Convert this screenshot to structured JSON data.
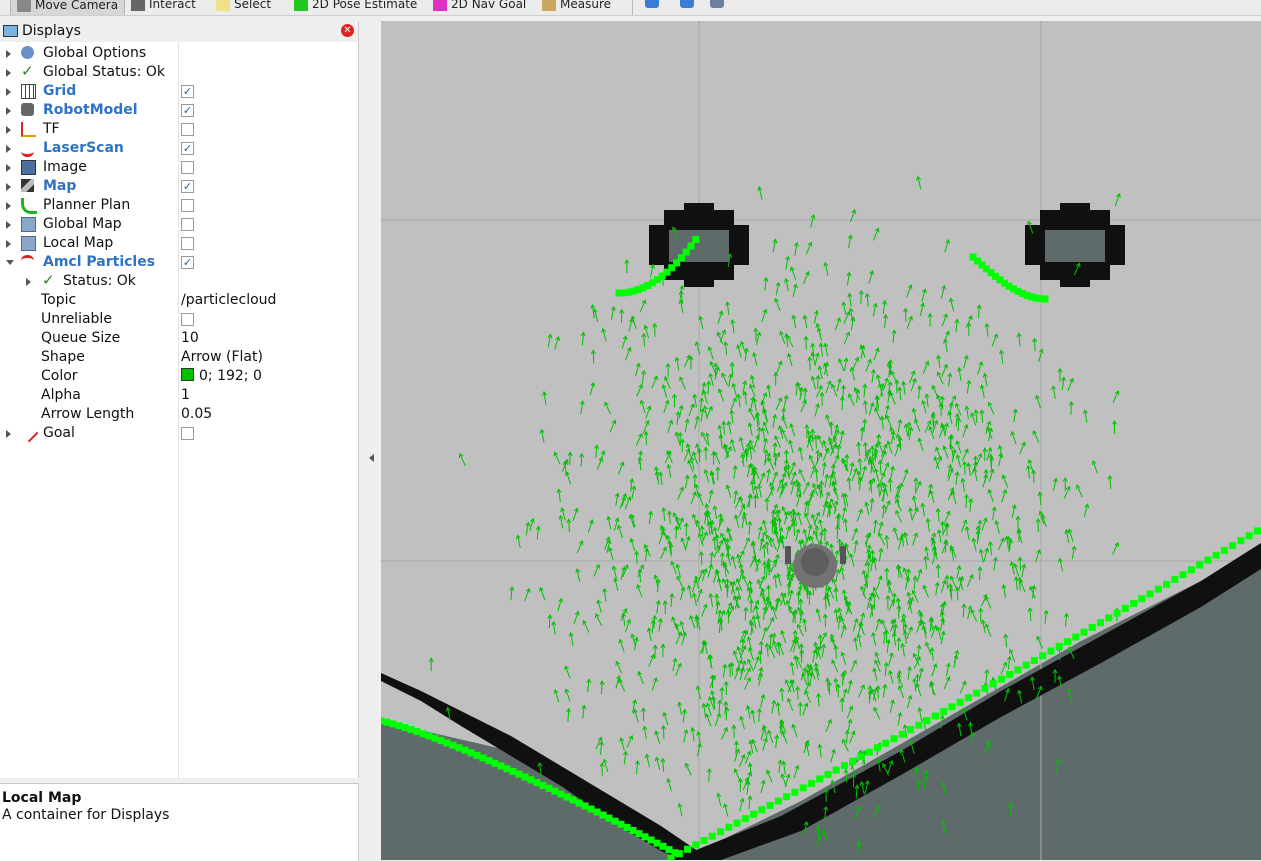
{
  "toolbar": {
    "tools": [
      {
        "label": "Move Camera",
        "icon": "move-camera-icon",
        "active": true
      },
      {
        "label": "Interact",
        "icon": "interact-icon"
      },
      {
        "label": "Select",
        "icon": "select-icon"
      },
      {
        "label": "2D Pose Estimate",
        "icon": "pose-estimate-icon"
      },
      {
        "label": "2D Nav Goal",
        "icon": "nav-goal-icon"
      },
      {
        "label": "Measure",
        "icon": "measure-icon"
      }
    ]
  },
  "displays": {
    "title": "Displays",
    "rows": [
      {
        "label": "Global Options",
        "icon": "gear-icon"
      },
      {
        "label": "Global Status: Ok",
        "icon": "check-icon"
      },
      {
        "label": "Grid",
        "icon": "grid-icon",
        "checked": true
      },
      {
        "label": "RobotModel",
        "icon": "robot-icon",
        "checked": true
      },
      {
        "label": "TF",
        "icon": "tf-axes-icon",
        "checked": false
      },
      {
        "label": "LaserScan",
        "icon": "laser-scan-icon",
        "checked": true
      },
      {
        "label": "Image",
        "icon": "image-icon",
        "checked": false
      },
      {
        "label": "Map",
        "icon": "map-icon",
        "checked": true
      },
      {
        "label": "Planner Plan",
        "icon": "path-icon",
        "checked": false
      },
      {
        "label": "Global Map",
        "icon": "folder-icon",
        "checked": false
      },
      {
        "label": "Local Map",
        "icon": "folder-icon",
        "checked": false
      },
      {
        "label": "Amcl Particles",
        "icon": "pose-array-icon",
        "checked": true,
        "expanded": true
      },
      {
        "label": "Status: Ok",
        "icon": "check-icon",
        "child": true
      },
      {
        "label": "Topic",
        "value": "/particlecloud",
        "prop": true
      },
      {
        "label": "Unreliable",
        "prop": true,
        "checked": false
      },
      {
        "label": "Queue Size",
        "value": "10",
        "prop": true
      },
      {
        "label": "Shape",
        "value": "Arrow (Flat)",
        "prop": true
      },
      {
        "label": "Color",
        "value": "0; 192; 0",
        "prop": true,
        "swatch": "#00c000"
      },
      {
        "label": "Alpha",
        "value": "1",
        "prop": true
      },
      {
        "label": "Arrow Length",
        "value": "0.05",
        "prop": true
      },
      {
        "label": "Goal",
        "icon": "goal-arrow-icon",
        "checked": false
      }
    ]
  },
  "description": {
    "title": "Local Map",
    "text": "A container for Displays"
  },
  "colors": {
    "accent": "#2f73c2",
    "particle": "#00c000",
    "laser": "#00ff00",
    "free_space": "#c0c0c0",
    "occupied": "#101010",
    "unknown": "#5f6b6b"
  }
}
